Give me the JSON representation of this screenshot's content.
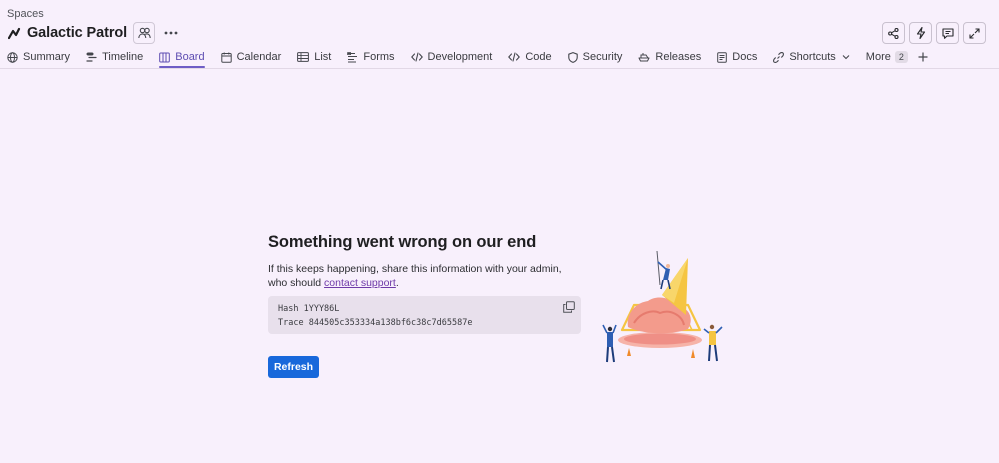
{
  "breadcrumb": "Spaces",
  "project": {
    "title": "Galactic Patrol"
  },
  "tabs": [
    {
      "label": "Summary",
      "icon": "globe-icon"
    },
    {
      "label": "Timeline",
      "icon": "timeline-icon"
    },
    {
      "label": "Board",
      "icon": "board-icon",
      "active": true
    },
    {
      "label": "Calendar",
      "icon": "calendar-icon"
    },
    {
      "label": "List",
      "icon": "list-icon"
    },
    {
      "label": "Forms",
      "icon": "forms-icon"
    },
    {
      "label": "Development",
      "icon": "code-brackets-icon"
    },
    {
      "label": "Code",
      "icon": "code-icon"
    },
    {
      "label": "Security",
      "icon": "shield-icon"
    },
    {
      "label": "Releases",
      "icon": "ship-icon"
    },
    {
      "label": "Docs",
      "icon": "document-icon"
    },
    {
      "label": "Shortcuts",
      "icon": "link-icon"
    },
    {
      "label": "More",
      "icon": "",
      "badge": "2"
    }
  ],
  "top_actions": [
    "share-icon",
    "lightning-icon",
    "feedback-icon",
    "fullscreen-icon"
  ],
  "error": {
    "title": "Something went wrong on our end",
    "message_before": "If this keeps happening, share this information with your admin, who should ",
    "link_text": "contact support",
    "message_after": ".",
    "hash_line": "Hash 1YYY86L",
    "trace_line": "Trace 844505c353334a138bf6c38c7d65587e",
    "refresh_label": "Refresh"
  },
  "colors": {
    "background": "#f8f0fc",
    "accent": "#6e5dc6",
    "primary_button": "#1868db",
    "link": "#6e3aa8"
  }
}
